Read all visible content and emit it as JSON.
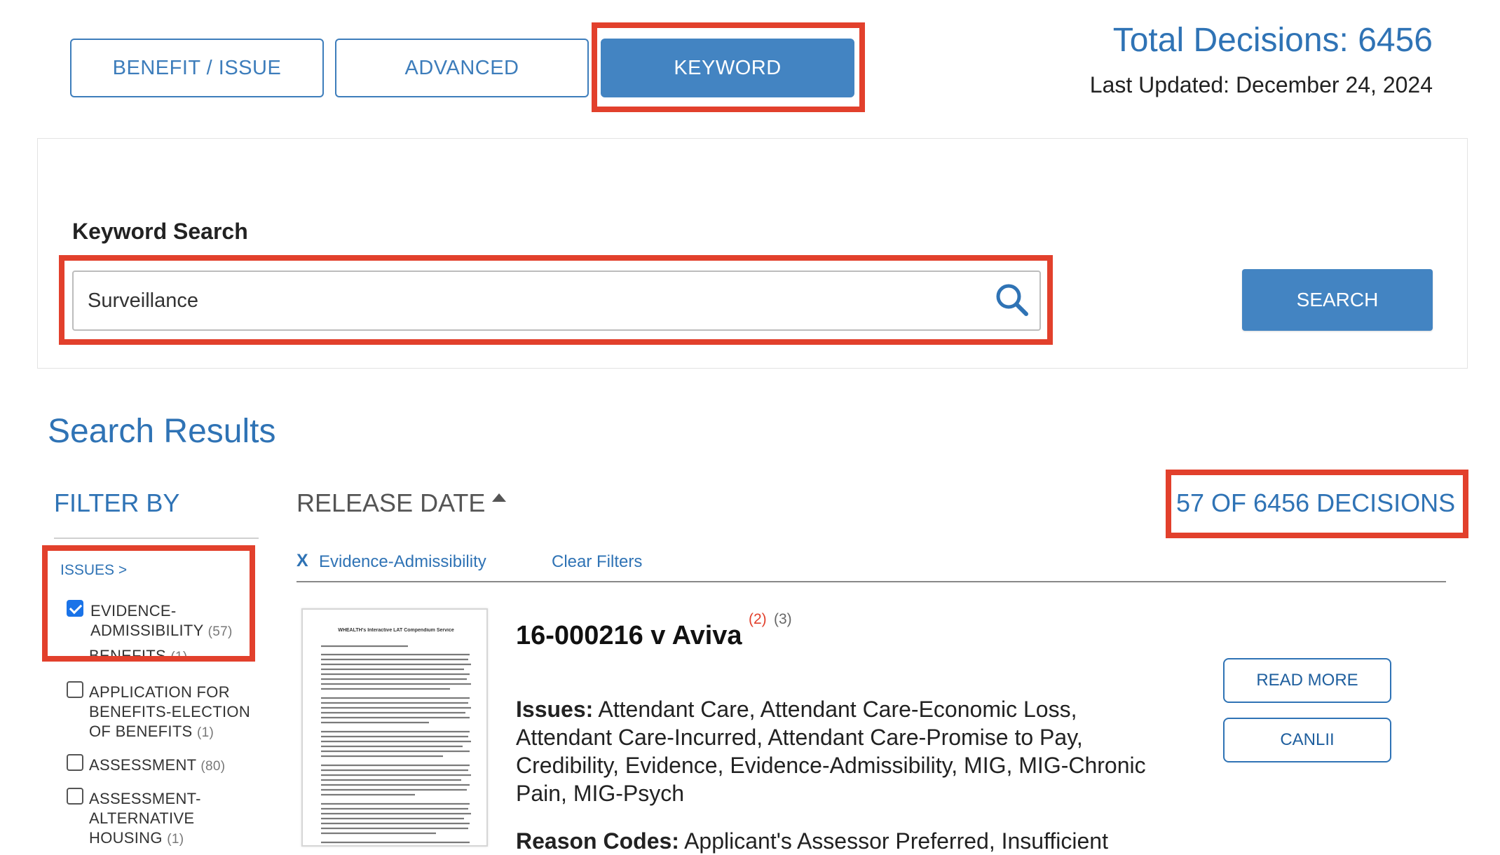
{
  "tabs": {
    "benefit_issue": "BENEFIT / ISSUE",
    "advanced": "ADVANCED",
    "keyword": "KEYWORD",
    "active": "keyword"
  },
  "header": {
    "total_decisions": "Total Decisions: 6456",
    "last_updated": "Last Updated: December 24, 2024"
  },
  "search": {
    "label": "Keyword Search",
    "value": "Surveillance",
    "button_label": "SEARCH"
  },
  "results": {
    "title": "Search Results",
    "filter_by": "FILTER BY",
    "sort_label": "RELEASE DATE",
    "count_label": "57 OF 6456 DECISIONS",
    "active_filter": "Evidence-Admissibility",
    "clear_filters": "Clear Filters"
  },
  "filters": {
    "issues_link": "ISSUES >",
    "items": [
      {
        "label_line1": "EVIDENCE-",
        "label_line2": "ADMISSIBILITY",
        "count": "(57)",
        "checked": true
      },
      {
        "label_partial": "BENEFITS",
        "count": "(1)",
        "checked": false
      },
      {
        "label_line1": "APPLICATION FOR",
        "label_line2": "BENEFITS-ELECTION",
        "label_line3": "OF BENEFITS",
        "count": "(1)",
        "checked": false
      },
      {
        "label_line1": "ASSESSMENT",
        "count": "(80)",
        "checked": false
      },
      {
        "label_line1": "ASSESSMENT-",
        "label_line2": "ALTERNATIVE",
        "label_line3": "HOUSING",
        "count": "(1)",
        "checked": false
      }
    ]
  },
  "decision": {
    "title": "16-000216 v Aviva",
    "sup_red": "(2)",
    "sup_grey": "(3)",
    "issues_label": "Issues:",
    "issues_text": "Attendant Care, Attendant Care-Economic Loss, Attendant Care-Incurred, Attendant Care-Promise to Pay, Credibility, Evidence, Evidence-Admissibility, MIG, MIG-Chronic Pain, MIG-Psych",
    "reason_label": "Reason Codes:",
    "reason_text": "Applicant's Assessor Preferred, Insufficient",
    "thumb_header": "WHEALTH's Interactive LAT Compendium Service",
    "read_more": "READ MORE",
    "canlii": "CANLII"
  },
  "colors": {
    "accent": "#4384c2",
    "link": "#2f73b5",
    "highlight": "#e2402c"
  }
}
